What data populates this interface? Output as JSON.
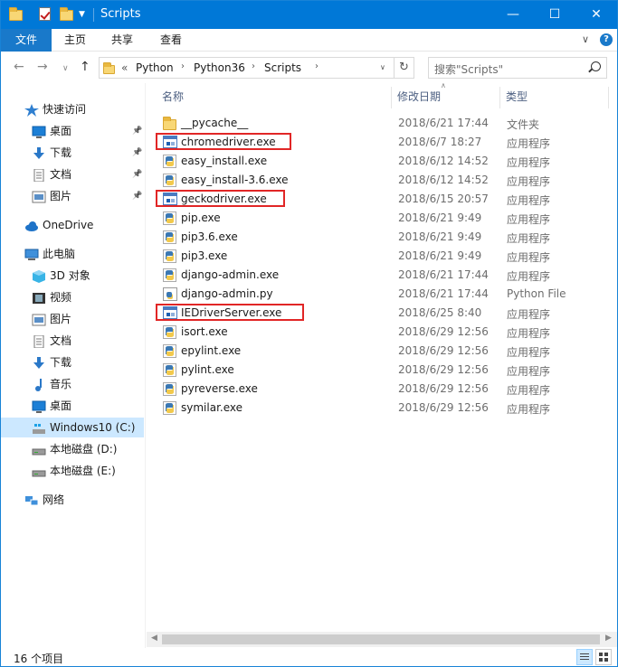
{
  "window": {
    "title": "Scripts",
    "minimize": "—",
    "maximize": "☐",
    "close": "✕"
  },
  "ribbon": {
    "tabs": [
      "文件",
      "主页",
      "共享",
      "查看"
    ],
    "expand": "∨",
    "help": "?"
  },
  "address": {
    "overflow": "«",
    "path": [
      "Python",
      "Python36",
      "Scripts"
    ],
    "search_placeholder": "搜索\"Scripts\""
  },
  "nav": [
    {
      "label": "快速访问",
      "icon": "star-icon",
      "pinned": false
    },
    {
      "label": "桌面",
      "icon": "desktop-icon",
      "pinned": true
    },
    {
      "label": "下载",
      "icon": "download-icon",
      "pinned": true
    },
    {
      "label": "文档",
      "icon": "document-icon",
      "pinned": true
    },
    {
      "label": "图片",
      "icon": "picture-icon",
      "pinned": true
    },
    {
      "label": "OneDrive",
      "icon": "cloud-icon",
      "pinned": false
    },
    {
      "label": "此电脑",
      "icon": "computer-icon",
      "pinned": false
    },
    {
      "label": "3D 对象",
      "icon": "cube-icon",
      "pinned": false
    },
    {
      "label": "视频",
      "icon": "video-icon",
      "pinned": false
    },
    {
      "label": "图片",
      "icon": "picture-icon",
      "pinned": false
    },
    {
      "label": "文档",
      "icon": "document-icon",
      "pinned": false
    },
    {
      "label": "下载",
      "icon": "download-icon",
      "pinned": false
    },
    {
      "label": "音乐",
      "icon": "music-icon",
      "pinned": false
    },
    {
      "label": "桌面",
      "icon": "desktop-icon",
      "pinned": false
    },
    {
      "label": "Windows10 (C:)",
      "icon": "drive-c-icon",
      "pinned": false,
      "selected": true
    },
    {
      "label": "本地磁盘 (D:)",
      "icon": "drive-icon",
      "pinned": false
    },
    {
      "label": "本地磁盘 (E:)",
      "icon": "drive-icon",
      "pinned": false
    },
    {
      "label": "网络",
      "icon": "network-icon",
      "pinned": false
    }
  ],
  "columns": {
    "name": "名称",
    "date": "修改日期",
    "type": "类型"
  },
  "files": [
    {
      "name": "__pycache__",
      "date": "2018/6/21 17:44",
      "type": "文件夹",
      "icon": "folder-icon",
      "highlighted": false
    },
    {
      "name": "chromedriver.exe",
      "date": "2018/6/7 18:27",
      "type": "应用程序",
      "icon": "exe-icon",
      "highlighted": true
    },
    {
      "name": "easy_install.exe",
      "date": "2018/6/12 14:52",
      "type": "应用程序",
      "icon": "python-exe-icon",
      "highlighted": false
    },
    {
      "name": "easy_install-3.6.exe",
      "date": "2018/6/12 14:52",
      "type": "应用程序",
      "icon": "python-exe-icon",
      "highlighted": false
    },
    {
      "name": "geckodriver.exe",
      "date": "2018/6/15 20:57",
      "type": "应用程序",
      "icon": "exe-icon",
      "highlighted": true
    },
    {
      "name": "pip.exe",
      "date": "2018/6/21 9:49",
      "type": "应用程序",
      "icon": "python-exe-icon",
      "highlighted": false
    },
    {
      "name": "pip3.6.exe",
      "date": "2018/6/21 9:49",
      "type": "应用程序",
      "icon": "python-exe-icon",
      "highlighted": false
    },
    {
      "name": "pip3.exe",
      "date": "2018/6/21 9:49",
      "type": "应用程序",
      "icon": "python-exe-icon",
      "highlighted": false
    },
    {
      "name": "django-admin.exe",
      "date": "2018/6/21 17:44",
      "type": "应用程序",
      "icon": "python-exe-icon",
      "highlighted": false
    },
    {
      "name": "django-admin.py",
      "date": "2018/6/21 17:44",
      "type": "Python File",
      "icon": "python-file-icon",
      "highlighted": false
    },
    {
      "name": "IEDriverServer.exe",
      "date": "2018/6/25 8:40",
      "type": "应用程序",
      "icon": "exe-icon",
      "highlighted": true
    },
    {
      "name": "isort.exe",
      "date": "2018/6/29 12:56",
      "type": "应用程序",
      "icon": "python-exe-icon",
      "highlighted": false
    },
    {
      "name": "epylint.exe",
      "date": "2018/6/29 12:56",
      "type": "应用程序",
      "icon": "python-exe-icon",
      "highlighted": false
    },
    {
      "name": "pylint.exe",
      "date": "2018/6/29 12:56",
      "type": "应用程序",
      "icon": "python-exe-icon",
      "highlighted": false
    },
    {
      "name": "pyreverse.exe",
      "date": "2018/6/29 12:56",
      "type": "应用程序",
      "icon": "python-exe-icon",
      "highlighted": false
    },
    {
      "name": "symilar.exe",
      "date": "2018/6/29 12:56",
      "type": "应用程序",
      "icon": "python-exe-icon",
      "highlighted": false
    }
  ],
  "status": {
    "count": "16 个项目"
  },
  "colors": {
    "accent": "#0078d7",
    "highlight_box": "#e12626",
    "selected_nav": "#cce8ff"
  }
}
